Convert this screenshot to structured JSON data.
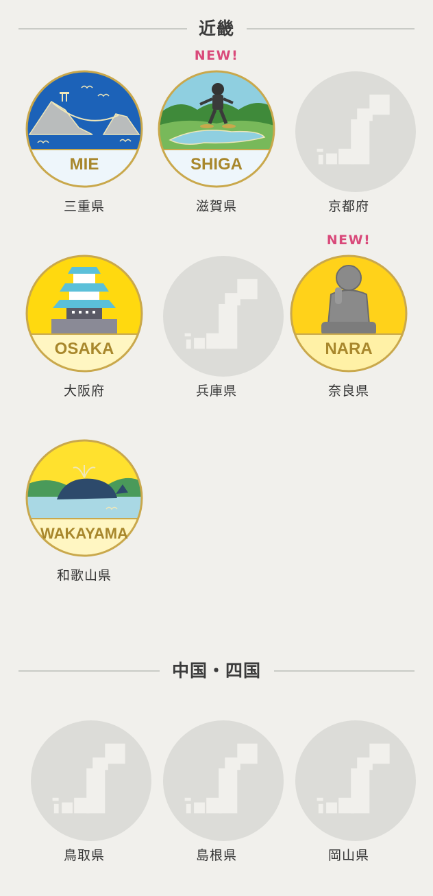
{
  "sections": [
    {
      "title": "近畿",
      "items": [
        {
          "name": "三重県",
          "badge": "MIE",
          "new": false
        },
        {
          "name": "滋賀県",
          "badge": "SHIGA",
          "new": true
        },
        {
          "name": "京都府",
          "badge": "",
          "new": false
        },
        {
          "name": "大阪府",
          "badge": "OSAKA",
          "new": false
        },
        {
          "name": "兵庫県",
          "badge": "",
          "new": false
        },
        {
          "name": "奈良県",
          "badge": "NARA",
          "new": true
        },
        {
          "name": "和歌山県",
          "badge": "WAKAYAMA",
          "new": false
        }
      ]
    },
    {
      "title": "中国・四国",
      "items": [
        {
          "name": "鳥取県",
          "badge": "",
          "new": false
        },
        {
          "name": "島根県",
          "badge": "",
          "new": false
        },
        {
          "name": "岡山県",
          "badge": "",
          "new": false
        }
      ]
    }
  ],
  "new_label": "NEW!",
  "colors": {
    "background": "#f1f0ec",
    "new_tag": "#d9497a",
    "locked_circle": "#dcdcd8",
    "badge_gold_text": "#a8872c"
  }
}
